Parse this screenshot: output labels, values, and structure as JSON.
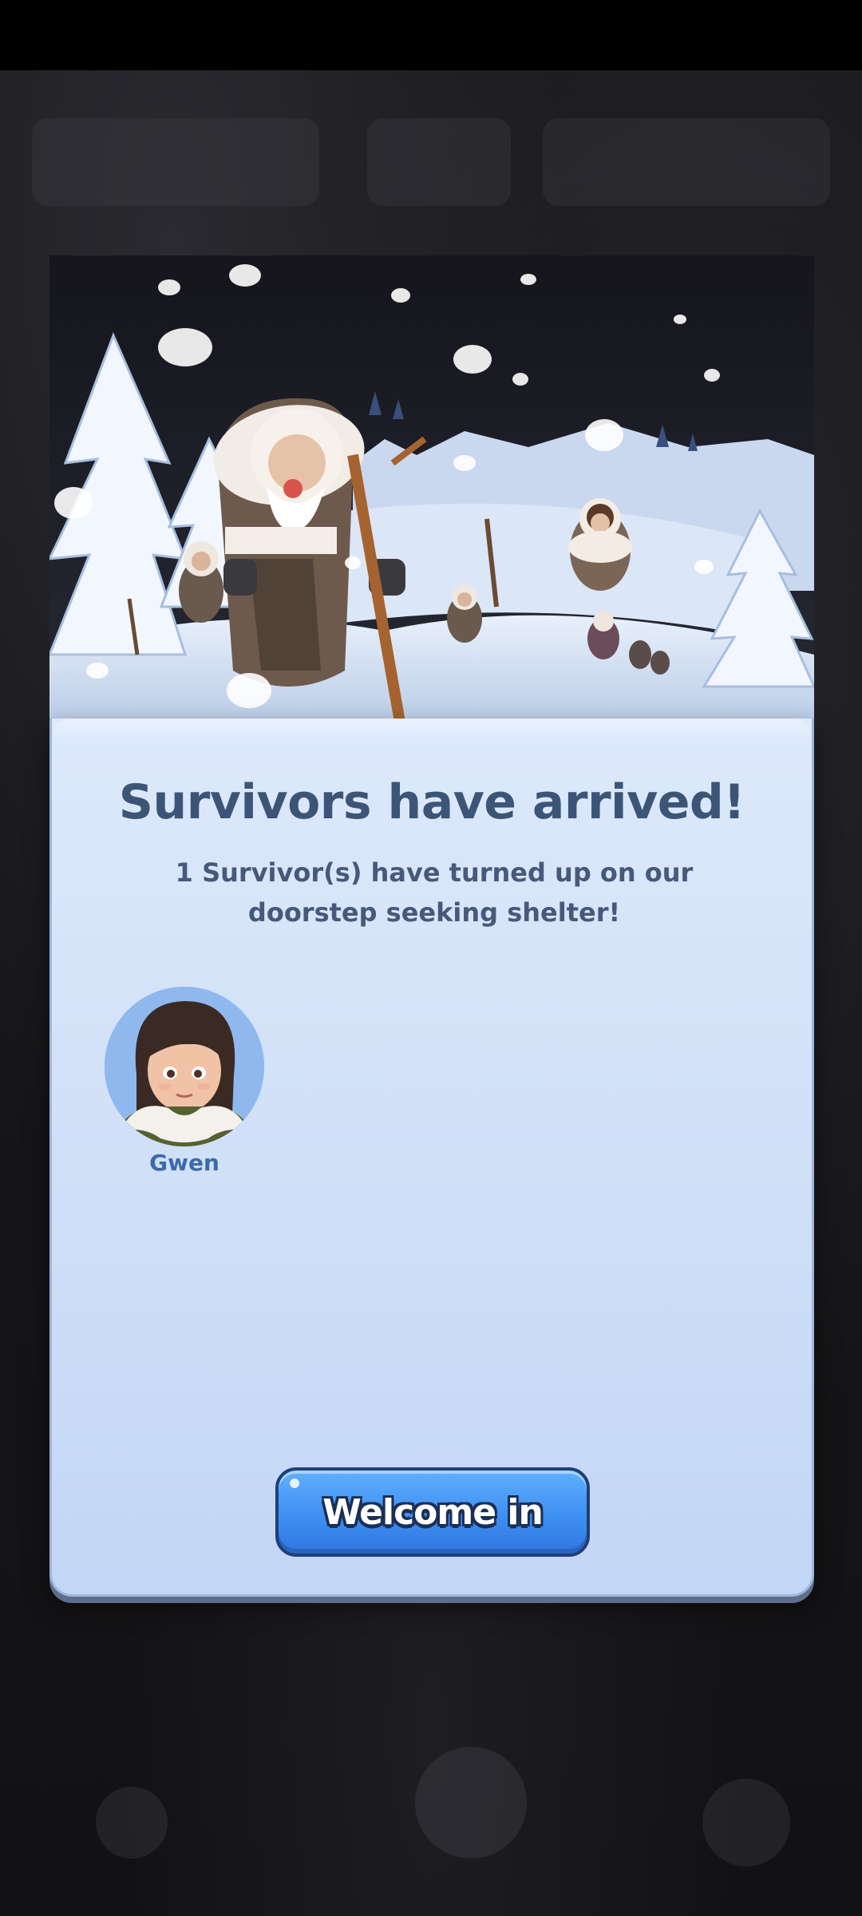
{
  "dialog": {
    "title": "Survivors have arrived!",
    "message": "1 Survivor(s) have turned up on our doorstep seeking shelter!",
    "survivors": [
      {
        "name": "Gwen"
      }
    ],
    "confirm_button": "Welcome in"
  },
  "colors": {
    "title_text": "#3c5577",
    "button_blue": "#3f8ff2",
    "panel_bg": "#cfdff7"
  }
}
